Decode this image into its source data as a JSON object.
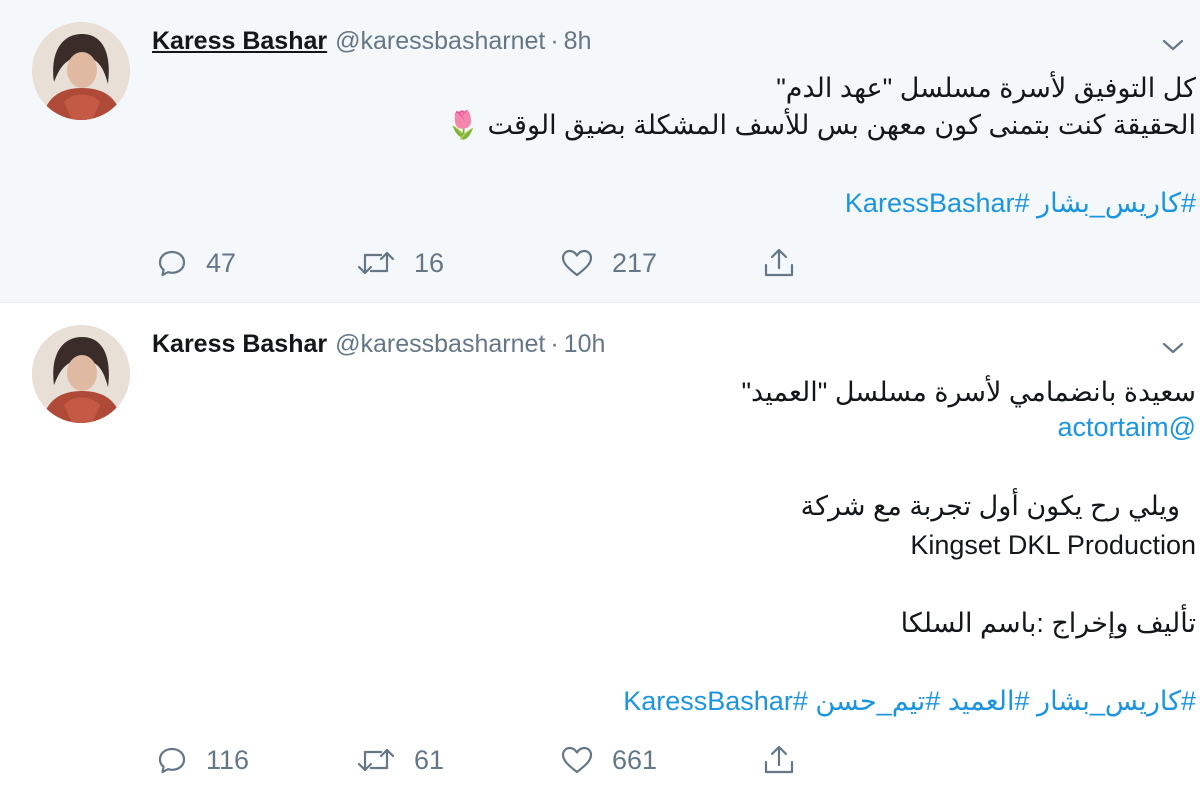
{
  "tweets": [
    {
      "name": "Karess Bashar",
      "handle": "@karessbasharnet",
      "dot": "·",
      "time": "8h",
      "lines": [
        "كل التوفيق لأسرة مسلسل \"عهد الدم\"",
        "الحقيقة كنت بتمنى كون معهن بس للأسف المشكلة بضيق الوقت"
      ],
      "emoji": "🌷",
      "hashtags": "#كاريس_بشار #KaressBashar",
      "counts": {
        "replies": "47",
        "retweets": "16",
        "likes": "217"
      }
    },
    {
      "name": "Karess Bashar",
      "handle": "@karessbasharnet",
      "dot": "·",
      "time": "10h",
      "lines": [
        "سعيدة بانضمامي لأسرة مسلسل \"العميد\"",
        "@actortaim",
        "ويلي رح يكون أول تجربة مع شركة",
        "Kingset DKL Production",
        "تأليف وإخراج :باسم السلكا"
      ],
      "hashtags": "#كاريس_بشار #العميد #تيم_حسن #KaressBashar",
      "counts": {
        "replies": "116",
        "retweets": "61",
        "likes": "661"
      }
    }
  ],
  "icons": {
    "reply": "reply-icon",
    "retweet": "retweet-icon",
    "like": "heart-icon",
    "share": "share-icon",
    "caret": "chevron-down-icon"
  },
  "colors": {
    "link": "#1b95e0",
    "secondary_text": "#657786",
    "highlight_bg": "#f5f8fa"
  }
}
